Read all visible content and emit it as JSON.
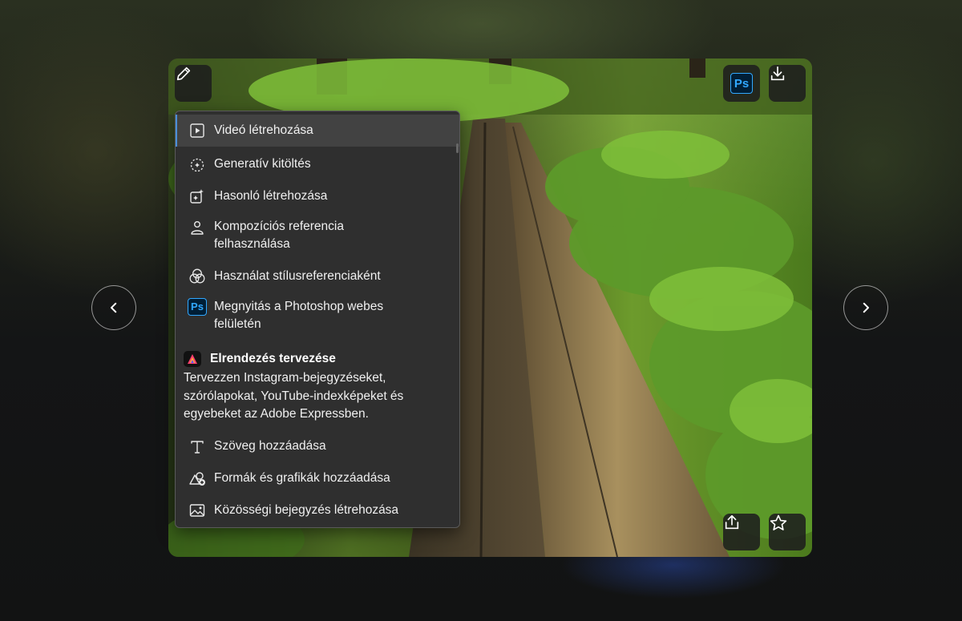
{
  "toolbar": {
    "edit_icon": "pencil-icon",
    "photoshop_badge": "Ps",
    "download_icon": "download-icon",
    "share_icon": "share-icon",
    "favorite_icon": "star-icon"
  },
  "navigation": {
    "prev_icon": "chevron-left-icon",
    "next_icon": "chevron-right-icon"
  },
  "menu": {
    "items": [
      {
        "label": "Videó létrehozása",
        "icon": "play-icon"
      },
      {
        "label": "Generatív kitöltés",
        "icon": "generative-fill-icon"
      },
      {
        "label": "Hasonló létrehozása",
        "icon": "generate-similar-icon"
      },
      {
        "label": "Kompozíciós referencia felhasználása",
        "icon": "composition-reference-icon"
      },
      {
        "label": "Használat stílusreferenciaként",
        "icon": "style-reference-icon"
      },
      {
        "label": "Megnyitás a Photoshop webes felületén",
        "icon": "photoshop-icon",
        "badge": "Ps"
      }
    ],
    "express": {
      "title": "Elrendezés tervezése",
      "description": "Tervezzen Instagram-bejegyzéseket, szórólapokat, YouTube-indexképeket és egyebeket az Adobe Expressben.",
      "icon": "adobe-express-icon"
    },
    "express_items": [
      {
        "label": "Szöveg hozzáadása",
        "icon": "text-icon"
      },
      {
        "label": "Formák és grafikák hozzáadása",
        "icon": "shapes-icon"
      },
      {
        "label": "Közösségi bejegyzés létrehozása",
        "icon": "image-icon"
      }
    ]
  },
  "colors": {
    "accent": "#4a8fd8",
    "menu_bg": "#2f2f2f",
    "photoshop_blue": "#31a8ff"
  }
}
